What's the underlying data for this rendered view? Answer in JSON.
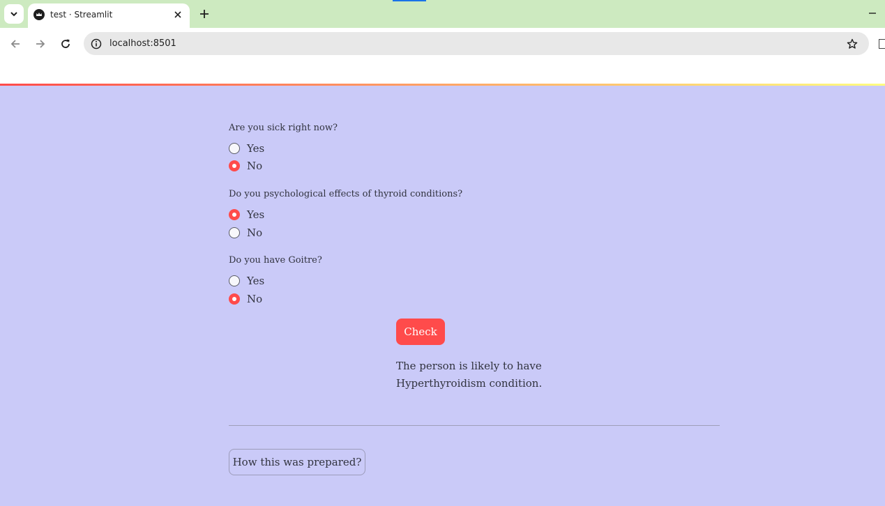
{
  "browser": {
    "tab_title": "test · Streamlit",
    "url": "localhost:8501"
  },
  "questions": [
    {
      "label": "Are you sick right now?",
      "options": [
        "Yes",
        "No"
      ],
      "selected": "No"
    },
    {
      "label": "Do you psychological effects of thyroid conditions?",
      "options": [
        "Yes",
        "No"
      ],
      "selected": "Yes"
    },
    {
      "label": "Do you have Goitre?",
      "options": [
        "Yes",
        "No"
      ],
      "selected": "No"
    }
  ],
  "check_button": {
    "label": "Check"
  },
  "result": {
    "text": "The person is likely to have Hyperthyroidism condition."
  },
  "expander": {
    "label": "How this was prepared?"
  },
  "colors": {
    "accent": "#ff4b4b",
    "page_background": "#cacaf8",
    "tabstrip": "#cdeac0",
    "text": "#31333f"
  }
}
